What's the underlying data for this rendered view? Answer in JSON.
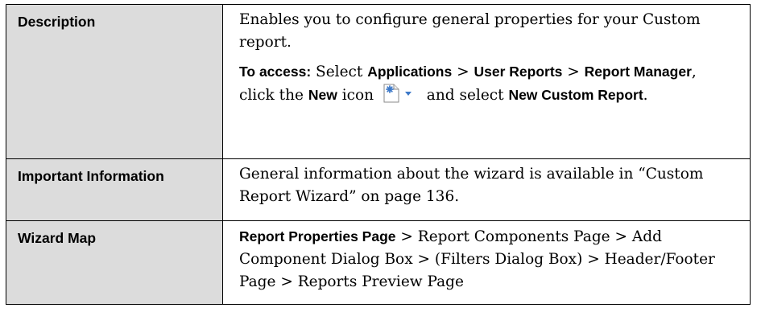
{
  "rows": [
    {
      "label": "Description",
      "desc_line": "Enables you to configure general properties for your Custom report.",
      "access": {
        "prefix": "To access:",
        "t1": " Select ",
        "applications": "Applications",
        "sep1": " > ",
        "user_reports": "User Reports",
        "sep2": " > ",
        "report_manager": "Report Manager",
        "t2": ", click the ",
        "new": "New",
        "t3": " icon ",
        "t4": " and select ",
        "new_custom_report": "New Custom Report",
        "t5": "."
      }
    },
    {
      "label": "Important Information",
      "text": "General information about the wizard is available in “Custom Report Wizard” on page 136."
    },
    {
      "label": "Wizard Map",
      "current": "Report Properties Page",
      "rest": " > Report Components Page > Add Component Dialog Box > (Filters Dialog Box) > Header/Footer Page > Reports Preview Page"
    }
  ],
  "icons": {
    "new_icon": "new-report-dropdown-icon",
    "accent": "#3c78c8"
  }
}
